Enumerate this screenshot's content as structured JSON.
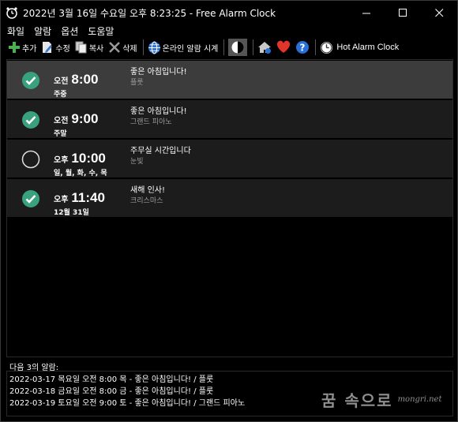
{
  "window": {
    "title": "2022년 3월 16일 수요일 오후 8:23:25 - Free Alarm Clock"
  },
  "menu": [
    "화일",
    "알람",
    "옵션",
    "도움말"
  ],
  "toolbar": {
    "add": "추가",
    "edit": "수정",
    "copy": "복사",
    "delete": "삭제",
    "online": "온라인 알람 시계",
    "hot": "Hot Alarm Clock"
  },
  "alarms": [
    {
      "enabled": true,
      "ampm": "오전",
      "time": "8:00",
      "days": "주중",
      "message": "좋은 아침입니다!",
      "sound": "플룻"
    },
    {
      "enabled": true,
      "ampm": "오전",
      "time": "9:00",
      "days": "주말",
      "message": "좋은 아침입니다!",
      "sound": "그랜드 피아노"
    },
    {
      "enabled": false,
      "ampm": "오후",
      "time": "10:00",
      "days": "일, 월, 화, 수, 목",
      "message": "주무실 시간입니다",
      "sound": "눈빛"
    },
    {
      "enabled": true,
      "ampm": "오후",
      "time": "11:40",
      "days": "12월 31일",
      "message": "새해 인사!",
      "sound": "크리스마스"
    }
  ],
  "next": {
    "label": "다음 3의 알람:",
    "items": [
      "2022-03-17 목요일 오전 8:00 목 - 좋은 아침입니다! / 플룻",
      "2022-03-18 금요일 오전 8:00 금 - 좋은 아침입니다! / 플룻",
      "2022-03-19 토요일 오전 9:00 토 - 좋은 아침입니다! / 그랜드 피아노"
    ]
  },
  "watermark": {
    "main": "꿈 속으로",
    "sub": "mongri.net"
  },
  "colors": {
    "check": "#3aa17e",
    "selected_row": "#3c3c3c",
    "row": "#1c1c1c",
    "heart": "#e0342c",
    "help": "#2a6fd6"
  }
}
